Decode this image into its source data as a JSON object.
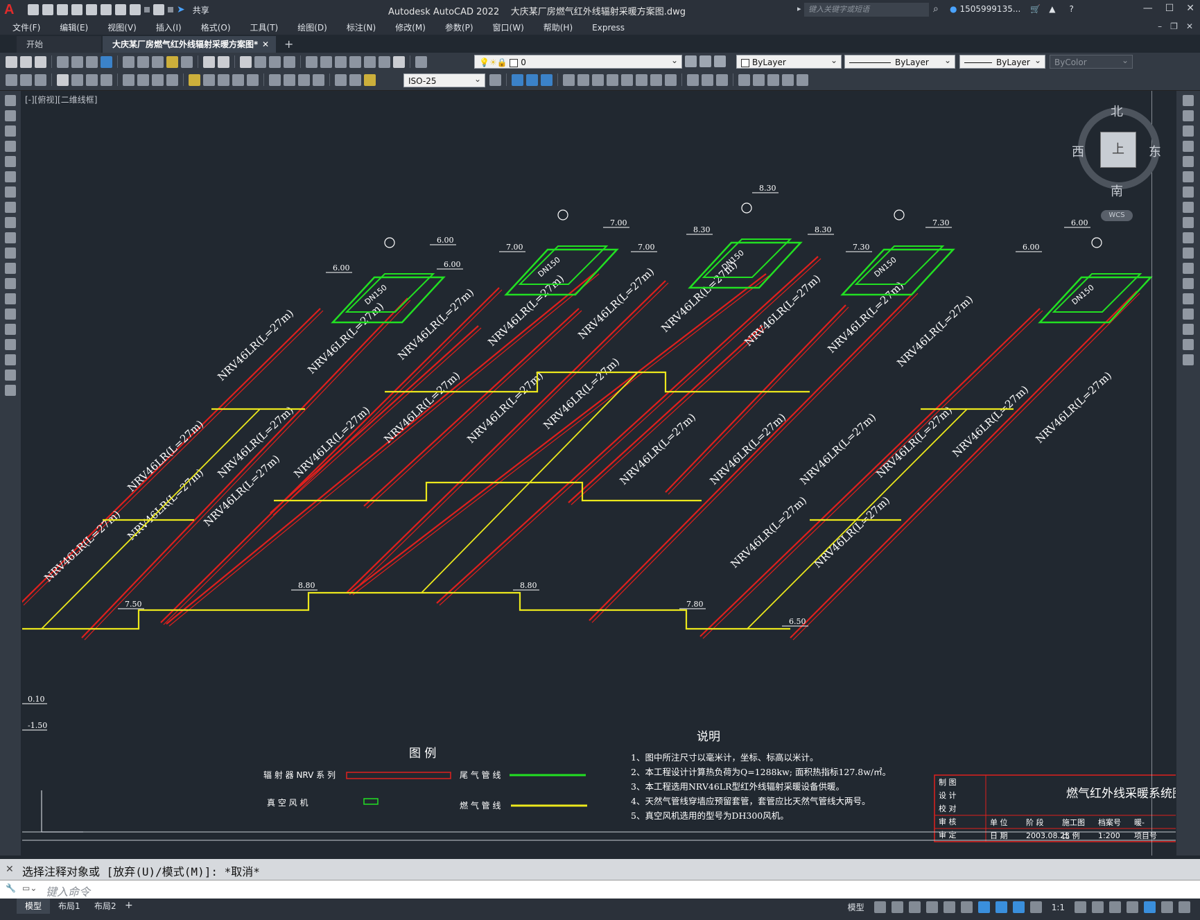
{
  "app": {
    "title": "Autodesk AutoCAD 2022",
    "file_title": "大庆某厂房燃气红外线辐射采暖方案图.dwg",
    "share_label": "共享",
    "search_placeholder": "键入关键字或短语",
    "user_name": "1505999135..."
  },
  "menus": [
    "文件(F)",
    "编辑(E)",
    "视图(V)",
    "插入(I)",
    "格式(O)",
    "工具(T)",
    "绘图(D)",
    "标注(N)",
    "修改(M)",
    "参数(P)",
    "窗口(W)",
    "帮助(H)",
    "Express"
  ],
  "tabs": [
    {
      "label": "开始"
    },
    {
      "label": "大庆某厂房燃气红外线辐射采暖方案图*",
      "close": "✕"
    }
  ],
  "toolbar": {
    "layer": "0",
    "color": "ByLayer",
    "linetype": "ByLayer",
    "lineweight": "ByLayer",
    "plotstyle": "ByColor",
    "dimstyle": "ISO-25"
  },
  "viewport_label": "[-][俯视][二维线框]",
  "viewcube": {
    "north": "北",
    "south": "南",
    "east": "东",
    "west": "西",
    "face": "上",
    "wcs": "WCS"
  },
  "drawing": {
    "pipe_label": "NRV46LR(L=27m)",
    "elevations": [
      "6.00",
      "7.00",
      "8.30",
      "7.30",
      "6.50",
      "7.80",
      "8.80",
      "7.50",
      "0.10",
      "-1.50"
    ],
    "box_label": "DN150",
    "legend_title": "图    例",
    "legend_items": [
      "辐 射 器 NRV 系 列",
      "尾 气 管 线",
      "真 空 风 机",
      "燃 气 管 线"
    ],
    "notes_title": "说明",
    "notes": [
      "1、图中所注尺寸以毫米计，坐标、标高以米计。",
      "2、本工程设计计算热负荷为Q=1288kw; 面积热指标127.8w/㎡。",
      "3、本工程选用NRV46LR型红外线辐射采暖设备供暖。",
      "4、天然气管线穿墙应预留套管，套管应比天然气管线大两号。",
      "5、真空风机选用的型号为DH300风机。"
    ],
    "titleblock": {
      "title": "燃气红外线采暖系统图",
      "roles": [
        "制 图",
        "设 计",
        "校 对",
        "审 核",
        "审 定"
      ],
      "row4": [
        "单 位",
        "阶 段",
        "施工图",
        "档案号",
        "暖-"
      ],
      "row5": [
        "日 期",
        "2003.08.25",
        "比 例",
        "1:200",
        "项目号"
      ]
    }
  },
  "command": {
    "history": "选择注释对象或 [放弃(U)/模式(M)]: *取消*",
    "placeholder": "键入命令"
  },
  "layout_tabs": [
    "模型",
    "布局1",
    "布局2"
  ],
  "status": {
    "model_label": "模型",
    "scale": "1:1"
  },
  "colors": {
    "red_pipe": "#e0201d",
    "green_pipe": "#22e022",
    "yellow_pipe": "#ece81c",
    "background": "#212830"
  }
}
